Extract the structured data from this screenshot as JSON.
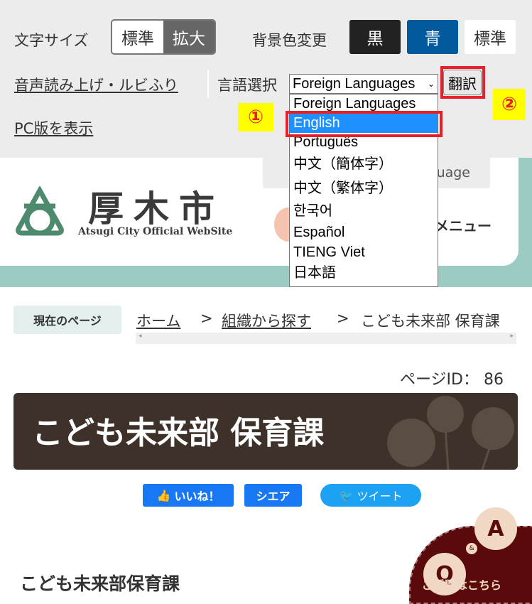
{
  "toolbar": {
    "font_size_label": "文字サイズ",
    "font_standard": "標準",
    "font_large": "拡大",
    "bg_label": "背景色変更",
    "bg_black": "黒",
    "bg_blue": "青",
    "bg_standard": "標準",
    "read_aloud": "音声読み上げ・ルビふり",
    "lang_label": "言語選択",
    "lang_selected": "Foreign Languages",
    "translate": "翻訳",
    "pc_view": "PC版を表示"
  },
  "annotations": {
    "step1": "①",
    "step2": "②"
  },
  "language_options": [
    "Foreign Languages",
    "English",
    "Português",
    "中文（簡体字）",
    "中文（繁体字）",
    "한국어",
    "Español",
    "TIENG Viet",
    "日本語"
  ],
  "header": {
    "logo_kanji": "厚木市",
    "logo_en": "Atsugi City Official WebSite",
    "select_language_partial": "uage",
    "menu": "メニュー"
  },
  "breadcrumb": {
    "label": "現在のページ",
    "items": [
      "ホーム",
      "組織から探す",
      "こども未来部 保育課"
    ],
    "separator": ">"
  },
  "page": {
    "id_label": "ページID：",
    "id": "86",
    "title": "こども未来部 保育課",
    "section_heading": "こども未来部保育課"
  },
  "social": {
    "like": "いいね！",
    "share": "シエア",
    "tweet": "ツイート"
  },
  "qa": {
    "q": "Q",
    "amp": "&",
    "a": "A",
    "label": "ご質問はこちら"
  },
  "colors": {
    "blue_bg": "#005a9c",
    "black_bg": "#222222",
    "highlight": "#1e90ff",
    "annotation_red": "#e8202a",
    "banner": "#3d3129",
    "teal": "#9ccbc3",
    "qa_bg": "#5a0a0a"
  }
}
